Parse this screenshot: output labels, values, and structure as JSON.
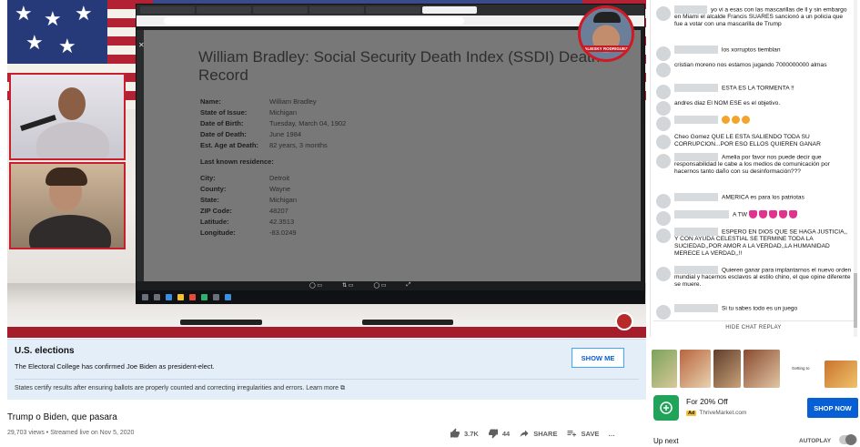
{
  "video": {
    "document_title": "William Bradley: Social Security Death Index (SSDI) Death Record",
    "fields": [
      {
        "label": "Name:",
        "value": "William Bradley"
      },
      {
        "label": "State of Issue:",
        "value": "Michigan"
      },
      {
        "label": "Date of Birth:",
        "value": "Tuesday, March 04, 1902"
      },
      {
        "label": "Date of Death:",
        "value": "June 1984"
      },
      {
        "label": "Est. Age at Death:",
        "value": "82 years, 3 months"
      }
    ],
    "residence_heading": "Last known residence:",
    "residence": [
      {
        "label": "City:",
        "value": "Detroit"
      },
      {
        "label": "County:",
        "value": "Wayne"
      },
      {
        "label": "State:",
        "value": "Michigan"
      },
      {
        "label": "ZIP Code:",
        "value": "48207"
      },
      {
        "label": "Latitude:",
        "value": "42.3513"
      },
      {
        "label": "Longitude:",
        "value": "-83.0249"
      }
    ],
    "streamer_tag": "ALIESKY RODRIGUEZ"
  },
  "info_panel": {
    "title": "U.S. elections",
    "description": "The Electoral College has confirmed Joe Biden as president-elect.",
    "button": "SHOW ME",
    "footer": "States certify results after ensuring ballots are properly counted and correcting irregularities and errors. Learn more ⧉"
  },
  "video_info": {
    "title": "Trump o Biden, que pasara",
    "meta": "29,703 views • Streamed live on Nov 5, 2020",
    "likes": "3.7K",
    "dislikes": "44",
    "share": "SHARE",
    "save": "SAVE",
    "more": "…"
  },
  "chat": {
    "messages": [
      {
        "text": "yo vi a esas con las mascarillas de ll y sin embargo en Miami el alcalde Francis SUARES sancionó a un policia que fue a votar con una mascarilla de Trump"
      },
      {
        "text": "los xorruptos tiemblan"
      },
      {
        "text": "cristian moreno  nos estamos jugando 7000000000 almas"
      },
      {
        "text": "ESTA ES LA TORMENTA !!"
      },
      {
        "text": "andres diaz  El NOM ESE es el objetivo."
      },
      {
        "text": ""
      },
      {
        "text": "Cheo Gomez  QUE LE ESTA SALIENDO TODA SU CORRUPCION...POR ESO ELLOS QUIEREN GANAR"
      },
      {
        "text": "Amelia por favor nos puede decir que responsabilidad le cabe a los medios de comunicación por hacernos tanto daño con su desinformación???"
      },
      {
        "text": "AMERICA es para los patriotas"
      },
      {
        "text": "A TW"
      },
      {
        "text": "ESPERO EN DIOS QUE SE HAGA JUSTICIA,, Y CON AYUDA CELESTIAL SE TERMINE TODA LA SUCIEDAD,,POR AMOR A LA VERDAD,,LA HUMANIDAD MERECE LA VERDAD,,!!"
      },
      {
        "text": "Quieren ganar para implantarnos el nuevo orden mundial y hacernos esclavos al estilo chino, el que opine diferente se muere."
      },
      {
        "text": "Si tu sabes todo es un juego"
      }
    ],
    "hide_label": "HIDE CHAT REPLAY"
  },
  "ad": {
    "title": "For 20% Off",
    "badge": "Ad",
    "advertiser": "ThriveMarket.com",
    "button": "SHOP NOW",
    "image_caption": "Getting to"
  },
  "sidebar": {
    "up_next": "Up next",
    "autoplay": "AUTOPLAY"
  }
}
